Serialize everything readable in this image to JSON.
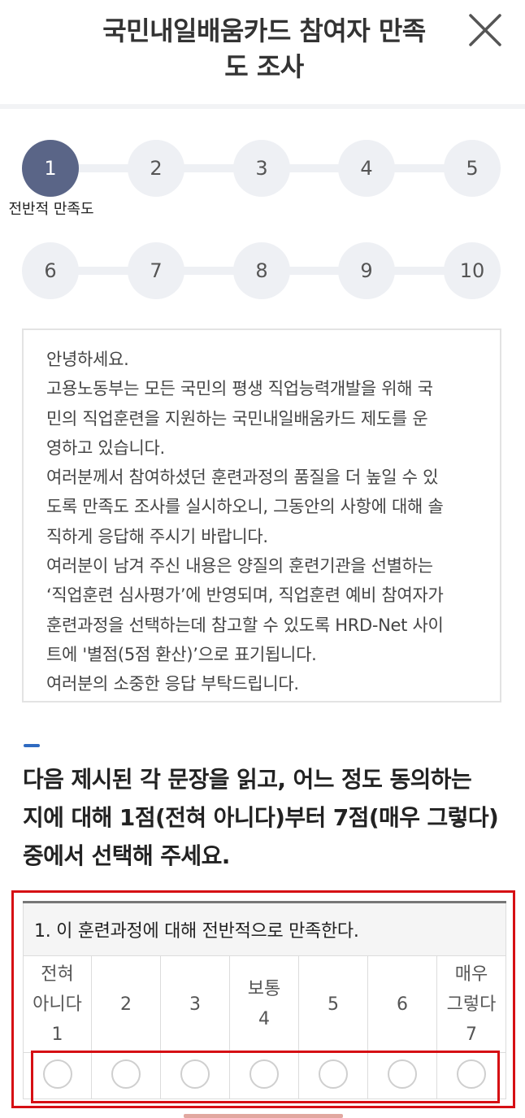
{
  "header": {
    "title_line1": "국민내일배움카드 참여자 만족",
    "title_line2": "도 조사",
    "close_icon": "close-x-icon"
  },
  "steps": {
    "row1": [
      "1",
      "2",
      "3",
      "4",
      "5"
    ],
    "row2": [
      "6",
      "7",
      "8",
      "9",
      "10"
    ],
    "active": "1",
    "active_label": "전반적 만족도",
    "active_color": "#5a6587",
    "inactive_color": "#eef0f4"
  },
  "notice": {
    "lines": [
      "안녕하세요.",
      "고용노동부는 모든 국민의 평생 직업능력개발을 위해 국",
      "민의 직업훈련을 지원하는 국민내일배움카드 제도를 운",
      "영하고 있습니다.",
      "여러분께서 참여하셨던 훈련과정의 품질을 더 높일 수 있",
      "도록 만족도 조사를 실시하오니, 그동안의 사항에 대해 솔",
      "직하게 응답해 주시기 바랍니다.",
      "여러분이 남겨 주신 내용은 양질의 훈련기관을 선별하는",
      "‘직업훈련 심사평가’에 반영되며, 직업훈련 예비 참여자가",
      "훈련과정을 선택하는데 참고할 수 있도록 HRD-Net 사이",
      "트에 '별점(5점 환산)’으로 표기됩니다.",
      "여러분의 소중한 응답 부탁드립니다."
    ]
  },
  "instruction": {
    "lines": [
      "다음 제시된 각 문장을 읽고, 어느 정도 동의하는",
      "지에 대해 1점(전혀 아니다)부터 7점(매우 그렇다)",
      "중에서 선택해 주세요."
    ]
  },
  "question": {
    "text": "1. 이 훈련과정에 대해 전반적으로 만족한다.",
    "scale_labels": [
      "전혀\n아니다\n1",
      "2",
      "3",
      "보통\n4",
      "5",
      "6",
      "매우\n그렇다\n7"
    ],
    "selected": null
  },
  "colors": {
    "highlight": "#d60f14",
    "accent": "#2f6ac1"
  }
}
